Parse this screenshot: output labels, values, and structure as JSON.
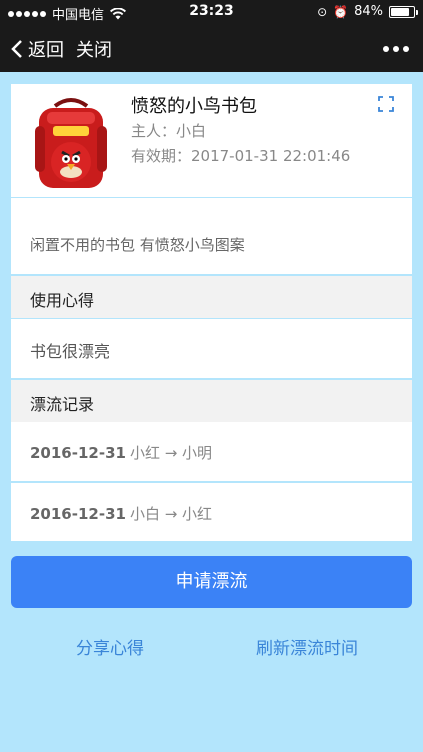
{
  "status": {
    "carrier": "中国电信",
    "time": "23:23",
    "battery": "84%",
    "battery_level": 0.84
  },
  "nav": {
    "back_label": "返回",
    "close_label": "关闭",
    "more_icon": "more-dots-icon"
  },
  "item": {
    "name": "愤怒的小鸟书包",
    "owner": "主人：小白",
    "expiry": "有效期：2017-01-31 22:01:46",
    "description": "闲置不用的书包 有愤怒小鸟图案",
    "image_label": "ANGRY BIRDS"
  },
  "experience": {
    "title": "使用心得",
    "text": "书包很漂亮"
  },
  "records": {
    "title": "漂流记录",
    "items": [
      {
        "date": "2016-12-31",
        "route": "小红 → 小明"
      },
      {
        "date": "2016-12-31",
        "route": "小白 → 小红"
      }
    ]
  },
  "actions": {
    "apply_label": "申请漂流",
    "share_label": "分享心得",
    "refresh_label": "刷新漂流时间"
  },
  "colors": {
    "background": "#b3e5fc",
    "primary": "#3b82f6",
    "link": "#3a85d8",
    "bar": "#1a1a1a"
  }
}
